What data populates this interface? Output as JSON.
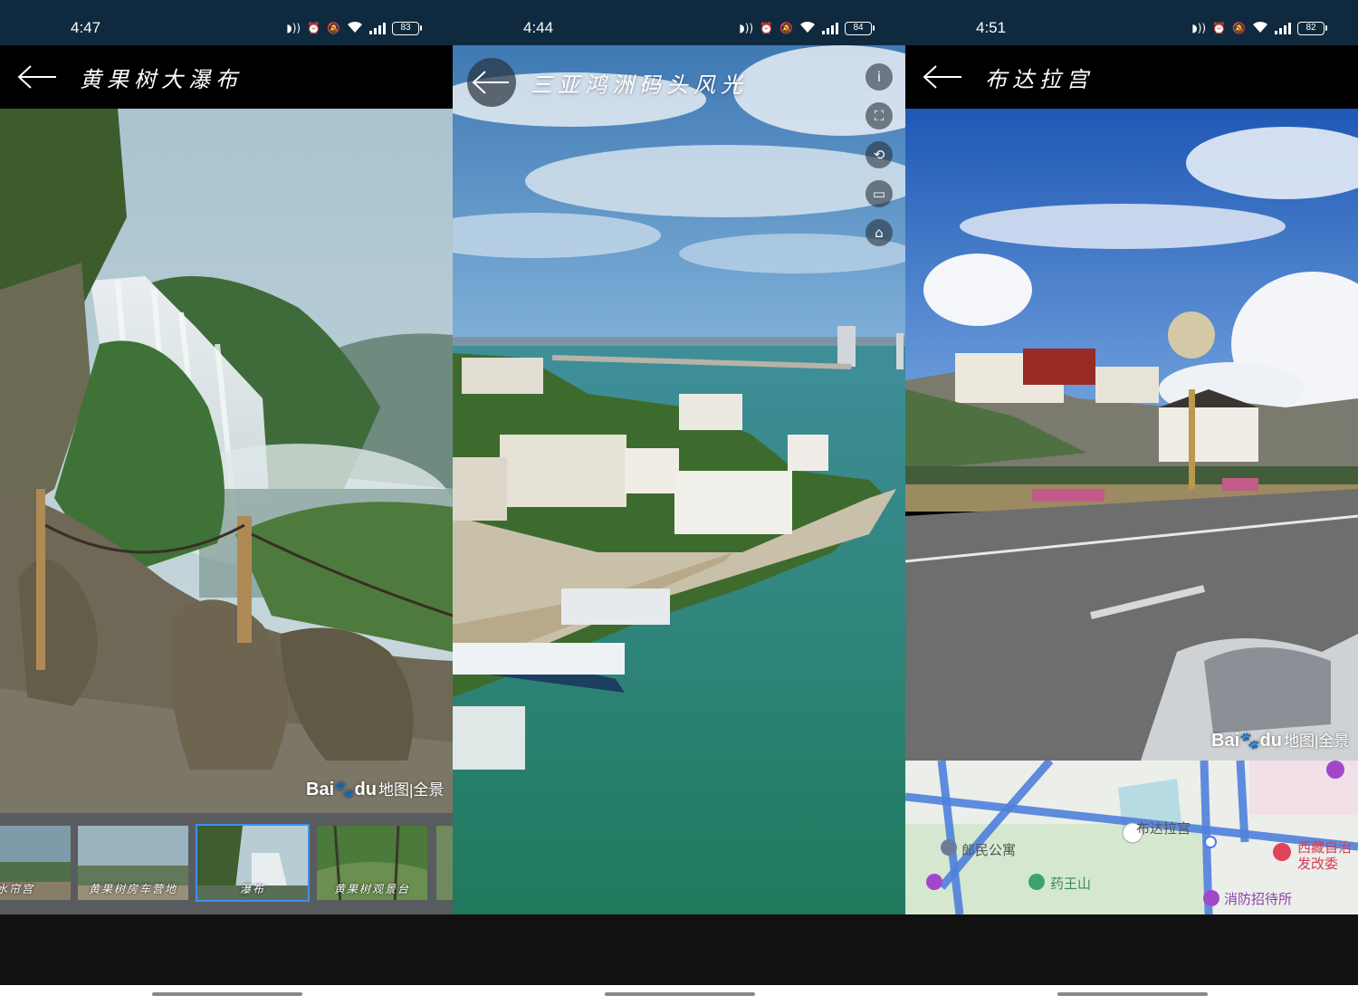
{
  "screens": [
    {
      "status": {
        "time": "4:47",
        "battery": "83"
      },
      "title": "黄果树大瀑布",
      "watermark": {
        "brand_a": "Bai",
        "brand_b": "du",
        "product": "地图|全景"
      },
      "thumbnails": [
        {
          "label": "水帘宫"
        },
        {
          "label": "黄果树房车营地"
        },
        {
          "label": "瀑布",
          "active": true
        },
        {
          "label": "黄果树观景台"
        }
      ]
    },
    {
      "status": {
        "time": "4:44",
        "battery": "84"
      },
      "title": "三亚鸿洲码头风光",
      "side_buttons": [
        "i",
        "⛶",
        "⟲",
        "▭",
        "⌂"
      ]
    },
    {
      "status": {
        "time": "4:51",
        "battery": "82"
      },
      "title": "布达拉宫",
      "watermark": {
        "brand_a": "Bai",
        "brand_b": "du",
        "product": "地图|全景"
      },
      "map_labels": {
        "apartment": "郎民公寓",
        "palace": "布达拉宫",
        "mountain": "药王山",
        "commission": "西藏自治",
        "commission2": "发改委",
        "fire": "消防招待所"
      }
    }
  ]
}
